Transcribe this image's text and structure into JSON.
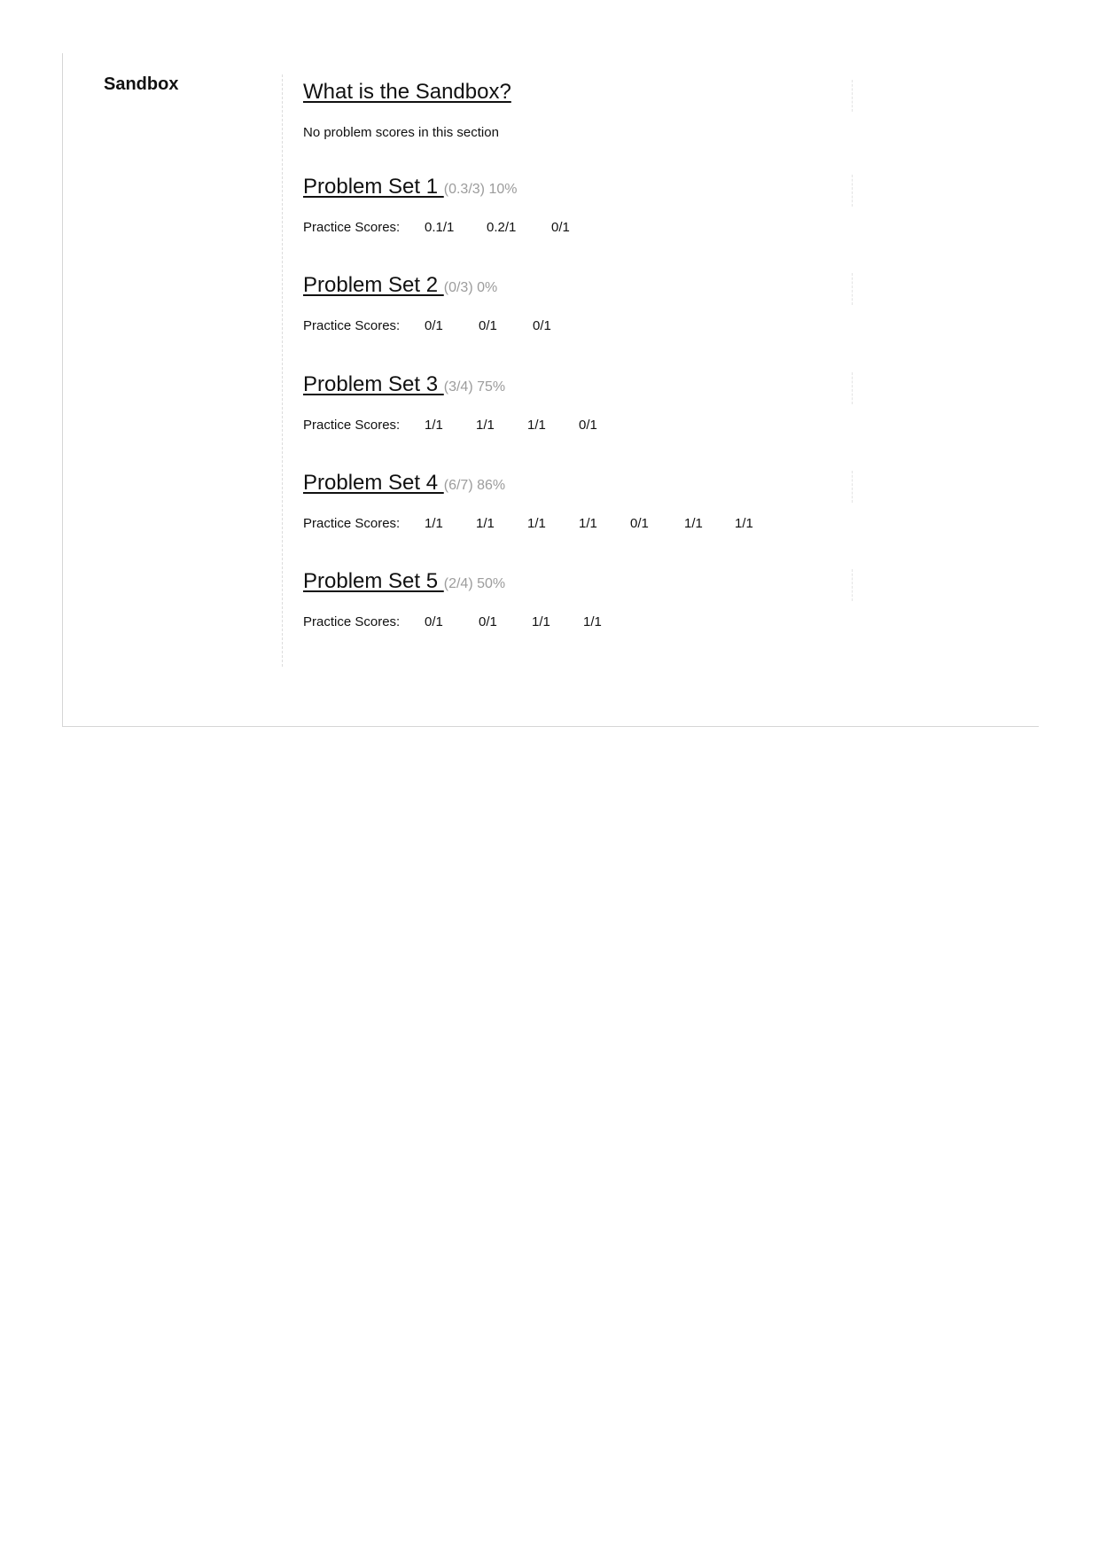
{
  "chapter": {
    "title": "Sandbox"
  },
  "sections": [
    {
      "title": "What is the Sandbox?",
      "note": "No problem scores in this section"
    },
    {
      "title": "Problem Set 1",
      "score_summary": "(0.3/3) 10%",
      "scores_label": "Practice Scores:",
      "scores": [
        "0.1/1",
        "0.2/1",
        "0/1"
      ]
    },
    {
      "title": "Problem Set 2",
      "score_summary": "(0/3) 0%",
      "scores_label": "Practice Scores:",
      "scores": [
        "0/1",
        "0/1",
        "0/1"
      ]
    },
    {
      "title": "Problem Set 3",
      "score_summary": "(3/4) 75%",
      "scores_label": "Practice Scores:",
      "scores": [
        "1/1",
        "1/1",
        "1/1",
        "0/1"
      ]
    },
    {
      "title": "Problem Set 4",
      "score_summary": "(6/7) 86%",
      "scores_label": "Practice Scores:",
      "scores": [
        "1/1",
        "1/1",
        "1/1",
        "1/1",
        "0/1",
        "1/1",
        "1/1"
      ]
    },
    {
      "title": "Problem Set 5",
      "score_summary": "(2/4) 50%",
      "scores_label": "Practice Scores:",
      "scores": [
        "0/1",
        "0/1",
        "1/1",
        "1/1"
      ]
    }
  ]
}
